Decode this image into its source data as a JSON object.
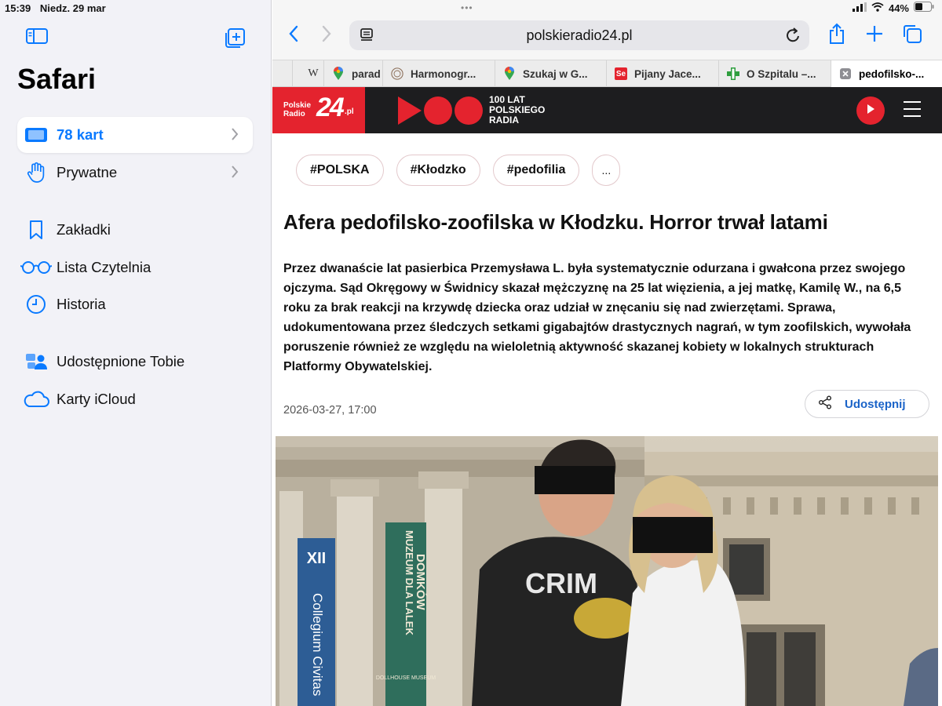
{
  "status": {
    "time": "15:39",
    "date": "Niedz. 29 mar",
    "battery": "44%"
  },
  "sidebar": {
    "title": "Safari",
    "items": [
      {
        "label": "78 kart",
        "icon": "tabs-icon",
        "active": true
      },
      {
        "label": "Prywatne",
        "icon": "hand-icon"
      },
      {
        "label": "Zakładki",
        "icon": "bookmark-icon"
      },
      {
        "label": "Lista Czytelnia",
        "icon": "glasses-icon"
      },
      {
        "label": "Historia",
        "icon": "clock-icon"
      },
      {
        "label": "Udostępnione Tobie",
        "icon": "shared-icon"
      },
      {
        "label": "Karty iCloud",
        "icon": "cloud-icon"
      }
    ]
  },
  "browser": {
    "url": "polskieradio24.pl",
    "tabs": [
      {
        "label": "",
        "favicon": "W"
      },
      {
        "label": "parad",
        "favicon": "maps-icon"
      },
      {
        "label": "Harmonogr...",
        "favicon": "seal-icon"
      },
      {
        "label": "Szukaj w G...",
        "favicon": "maps-icon"
      },
      {
        "label": "Pijany Jace...",
        "favicon": "Se"
      },
      {
        "label": "O Szpitalu –...",
        "favicon": "cross-icon"
      },
      {
        "label": "pedofilsko-...",
        "favicon": "close-icon",
        "active": true
      }
    ]
  },
  "site": {
    "logo_small": "Polskie Radio",
    "logo_big": "24",
    "logo_suffix": ".pl",
    "anniversary": "100 LAT POLSKIEGO RADIA",
    "accent": "#e4232e"
  },
  "article": {
    "tags": [
      "#POLSKA",
      "#Kłodzko",
      "#pedofilia",
      "..."
    ],
    "headline": "Afera pedofilsko-zoofilska w Kłodzku. Horror trwał latami",
    "lead": "Przez dwanaście lat pasierbica Przemysława L. była systematycznie odurzana i gwałcona przez swojego ojczyma. Sąd Okręgowy w Świdnicy skazał mężczyznę na 25 lat więzienia, a jej matkę, Kamilę W., na 6,5 roku za brak reakcji na krzywdę dziecka oraz udział w znęcaniu się nad zwierzętami. Sprawa, udokumentowana przez śledczych setkami gigabajtów drastycznych nagrań, w tym zoofilskich, wywołała poruszenie również ze względu na wieloletnią aktywność skazanej kobiety w lokalnych strukturach Platformy Obywatelskiej.",
    "date": "2026-03-27, 17:00",
    "share_label": "Udostępnij",
    "photo_banners": [
      "XII",
      "Collegium Civitas",
      "MUZEUM DLA LALEK",
      "DOMKÓW",
      "DOLLHOUSE MUSEUM"
    ],
    "shirt_text": "CRIM"
  }
}
